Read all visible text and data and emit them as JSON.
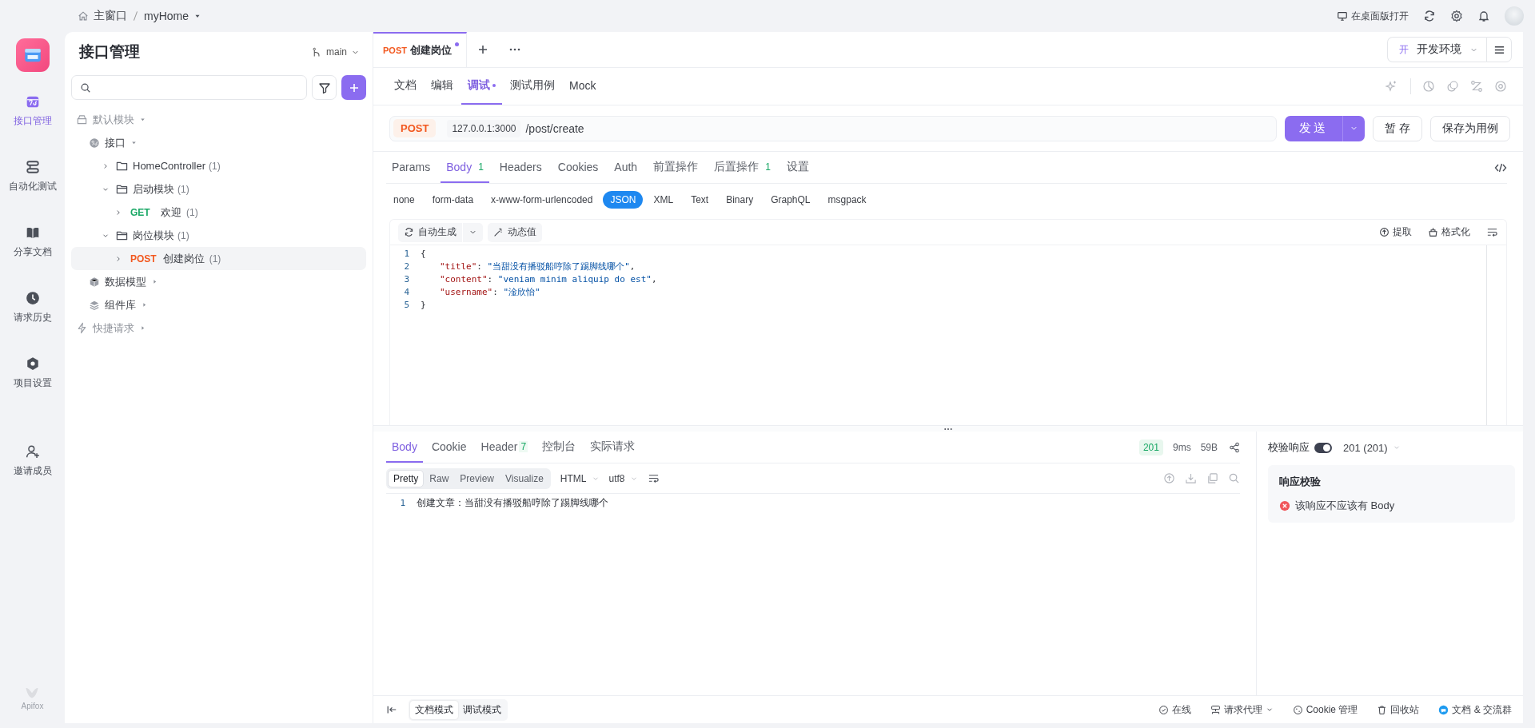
{
  "breadcrumb": {
    "home": "主窗口",
    "project": "myHome"
  },
  "top_actions": {
    "open_desktop": "在桌面版打开"
  },
  "nav_rail": {
    "items": [
      {
        "kind": "api",
        "label": "接口管理",
        "selected": true
      },
      {
        "kind": "automation",
        "label": "自动化测试",
        "selected": false
      },
      {
        "kind": "docs",
        "label": "分享文档",
        "selected": false
      },
      {
        "kind": "history",
        "label": "请求历史",
        "selected": false
      },
      {
        "kind": "settings",
        "label": "项目设置",
        "selected": false
      }
    ],
    "invite": "邀请成员",
    "logo_text": "Apifox"
  },
  "sidebar": {
    "title": "接口管理",
    "branch": "main",
    "tree": [
      {
        "kind": "module",
        "label": "默认模块",
        "expanded": true,
        "children": [
          {
            "kind": "api",
            "label": "接口",
            "expanded": true,
            "children": [
              {
                "kind": "folder",
                "label": "HomeController",
                "count": "(1)",
                "expanded": false
              },
              {
                "kind": "folder",
                "label": "启动模块",
                "count": "(1)",
                "expanded": true,
                "children": [
                  {
                    "kind": "endpoint",
                    "method": "GET",
                    "color": "#1aa866",
                    "label": "欢迎",
                    "count": "(1)",
                    "selected": false
                  }
                ]
              },
              {
                "kind": "folder",
                "label": "岗位模块",
                "count": "(1)",
                "expanded": true,
                "children": [
                  {
                    "kind": "endpoint",
                    "method": "POST",
                    "color": "#f2581f",
                    "label": "创建岗位",
                    "count": "(1)",
                    "selected": true
                  }
                ]
              }
            ]
          },
          {
            "kind": "models",
            "label": "数据模型",
            "expanded": false
          },
          {
            "kind": "components",
            "label": "组件库",
            "expanded": false
          }
        ]
      },
      {
        "kind": "quick",
        "label": "快捷请求",
        "expanded": false
      }
    ]
  },
  "open_tabs": [
    {
      "method": "POST",
      "title": "创建岗位",
      "selected": true,
      "unsaved": true
    }
  ],
  "environment": {
    "badge": "开",
    "name": "开发环境"
  },
  "sub_tabs": [
    {
      "label": "文档",
      "selected": false,
      "dot": false
    },
    {
      "label": "编辑",
      "selected": false,
      "dot": false
    },
    {
      "label": "调试",
      "selected": true,
      "dot": true
    },
    {
      "label": "测试用例",
      "selected": false,
      "dot": false
    },
    {
      "label": "Mock",
      "selected": false,
      "dot": false
    }
  ],
  "request": {
    "method": "POST",
    "host": "127.0.0.1:3000",
    "path": "/post/create",
    "send": "发送",
    "save": "暂 存",
    "save_case": "保存为用例"
  },
  "param_tabs": [
    {
      "label": "Params",
      "selected": false
    },
    {
      "label": "Body",
      "count": "1",
      "selected": true
    },
    {
      "label": "Headers",
      "selected": false
    },
    {
      "label": "Cookies",
      "selected": false
    },
    {
      "label": "Auth",
      "selected": false
    },
    {
      "label": "前置操作",
      "selected": false
    },
    {
      "label": "后置操作",
      "count": "1",
      "selected": false
    },
    {
      "label": "设置",
      "selected": false
    }
  ],
  "body_types": [
    {
      "label": "none",
      "selected": false
    },
    {
      "label": "form-data",
      "selected": false
    },
    {
      "label": "x-www-form-urlencoded",
      "selected": false
    },
    {
      "label": "JSON",
      "selected": true
    },
    {
      "label": "XML",
      "selected": false
    },
    {
      "label": "Text",
      "selected": false
    },
    {
      "label": "Binary",
      "selected": false
    },
    {
      "label": "GraphQL",
      "selected": false
    },
    {
      "label": "msgpack",
      "selected": false
    }
  ],
  "editor_toolbar": {
    "auto": "自动生成",
    "dynamic": "动态值",
    "extract": "提取",
    "format": "格式化"
  },
  "code_lines": [
    {
      "number": "1",
      "tokens": [
        {
          "kind": "punct",
          "text": "{"
        }
      ]
    },
    {
      "number": "2",
      "tokens": [
        {
          "kind": "key",
          "text": "\"title\""
        },
        {
          "kind": "punct",
          "text": ": "
        },
        {
          "kind": "string",
          "text": "\"当甜没有播驳船哼除了踢脚线哪个\""
        },
        {
          "kind": "punct",
          "text": ","
        }
      ]
    },
    {
      "number": "3",
      "tokens": [
        {
          "kind": "key",
          "text": "\"content\""
        },
        {
          "kind": "punct",
          "text": ": "
        },
        {
          "kind": "string",
          "text": "\"veniam minim aliquip do est\""
        },
        {
          "kind": "punct",
          "text": ","
        }
      ]
    },
    {
      "number": "4",
      "tokens": [
        {
          "kind": "key",
          "text": "\"username\""
        },
        {
          "kind": "punct",
          "text": ": "
        },
        {
          "kind": "string",
          "text": "\"淦欣怡\""
        }
      ]
    },
    {
      "number": "5",
      "tokens": [
        {
          "kind": "punct",
          "text": "}"
        }
      ]
    }
  ],
  "response": {
    "tabs": [
      {
        "label": "Body",
        "selected": true
      },
      {
        "label": "Cookie",
        "selected": false
      },
      {
        "label": "Header",
        "count": "7",
        "selected": false
      },
      {
        "label": "控制台",
        "selected": false
      },
      {
        "label": "实际请求",
        "selected": false
      }
    ],
    "status": "201",
    "time": "9ms",
    "size": "59B",
    "views": [
      {
        "label": "Pretty",
        "selected": true
      },
      {
        "label": "Raw",
        "selected": false
      },
      {
        "label": "Preview",
        "selected": false
      },
      {
        "label": "Visualize",
        "selected": false
      }
    ],
    "format": "HTML",
    "encoding": "utf8",
    "lines": [
      {
        "number": "1",
        "text": "创建文章：当甜没有播驳船哼除了踢脚线哪个"
      }
    ]
  },
  "validation": {
    "label": "校验响应",
    "on": true,
    "status": "201 (201)",
    "card_title": "响应校验",
    "error": "该响应不应该有 Body"
  },
  "footer": {
    "modes": [
      {
        "label": "文档模式",
        "selected": true
      },
      {
        "label": "调试模式",
        "selected": false
      }
    ],
    "items": [
      {
        "kind": "online",
        "label": "在线"
      },
      {
        "kind": "proxy",
        "label": "请求代理"
      },
      {
        "kind": "cookie",
        "label": "Cookie 管理"
      },
      {
        "kind": "trash",
        "label": "回收站"
      },
      {
        "kind": "community",
        "label": "文档 & 交流群"
      }
    ]
  }
}
